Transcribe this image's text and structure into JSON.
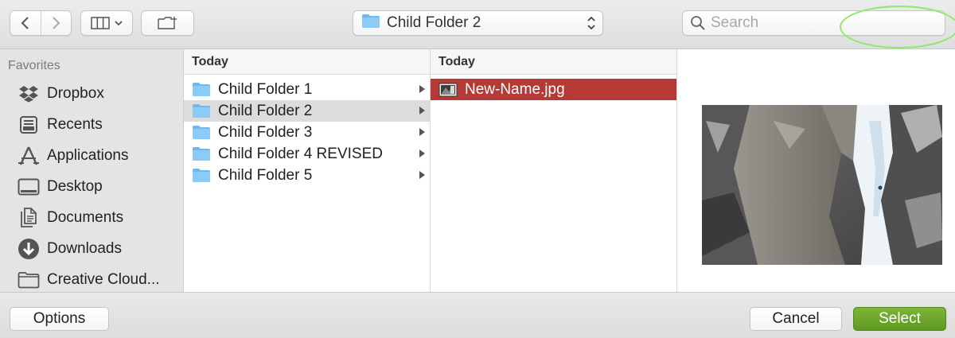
{
  "toolbar": {
    "back_icon": "chevron-left-icon",
    "forward_icon": "chevron-right-icon",
    "view_icon": "column-view-icon",
    "new_folder_icon": "new-folder-icon",
    "path_label": "Child Folder 2",
    "search_placeholder": "Search"
  },
  "sidebar": {
    "section_title": "Favorites",
    "items": [
      {
        "label": "Dropbox",
        "icon": "dropbox-icon"
      },
      {
        "label": "Recents",
        "icon": "recents-icon"
      },
      {
        "label": "Applications",
        "icon": "applications-icon"
      },
      {
        "label": "Desktop",
        "icon": "desktop-icon"
      },
      {
        "label": "Documents",
        "icon": "documents-icon"
      },
      {
        "label": "Downloads",
        "icon": "downloads-icon"
      },
      {
        "label": "Creative Cloud..."
      }
    ]
  },
  "column1": {
    "header": "Today",
    "rows": [
      {
        "label": "Child Folder 1"
      },
      {
        "label": "Child Folder 2",
        "selected": true
      },
      {
        "label": "Child Folder 3"
      },
      {
        "label": "Child Folder 4 REVISED"
      },
      {
        "label": "Child Folder 5"
      }
    ]
  },
  "column2": {
    "header": "Today",
    "rows": [
      {
        "label": "New-Name.jpg",
        "selected": true
      }
    ]
  },
  "bottom": {
    "options_label": "Options",
    "cancel_label": "Cancel",
    "select_label": "Select"
  },
  "colors": {
    "selection_red": "#b53a35",
    "select_button_green": "#6aa82a",
    "highlight_ring": "#8fe86a",
    "folder_blue": "#6cb8ef"
  }
}
